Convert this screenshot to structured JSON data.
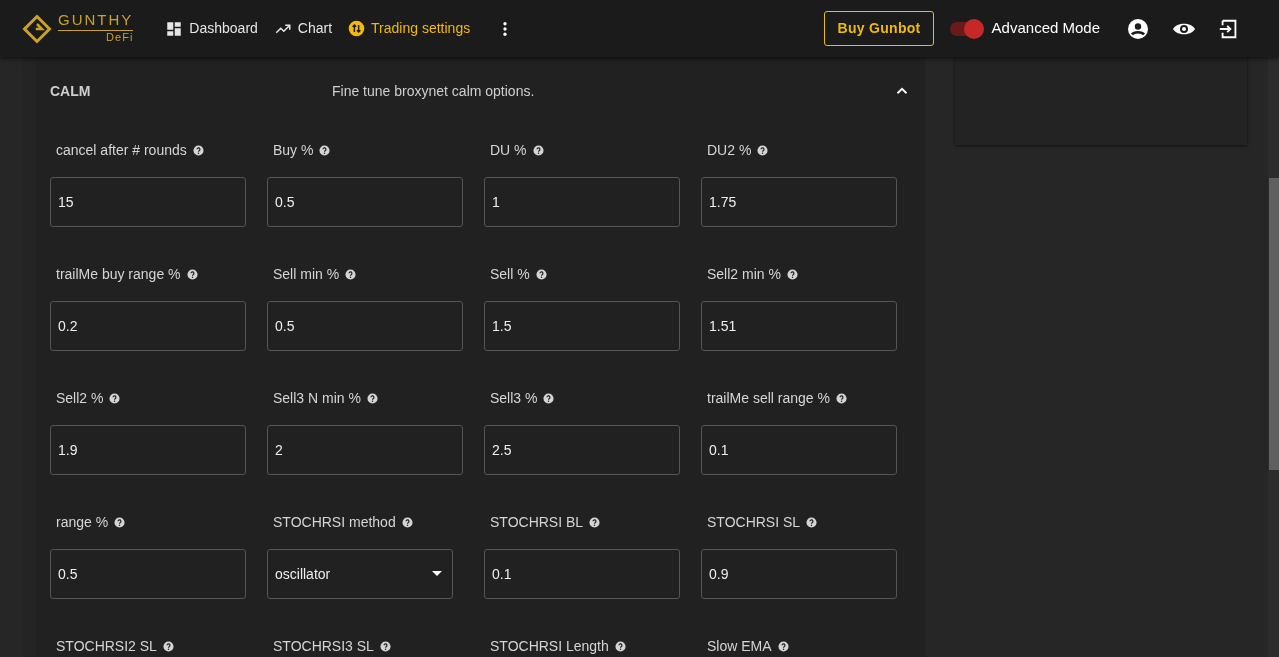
{
  "header": {
    "logo": {
      "name": "GUNTHY",
      "sub": "DeFi"
    },
    "nav": [
      {
        "label": "Dashboard",
        "selected": false
      },
      {
        "label": "Chart",
        "selected": false
      },
      {
        "label": "Trading settings",
        "selected": true
      }
    ],
    "buy_button": "Buy Gunbot",
    "advanced_mode": {
      "label": "Advanced Mode",
      "on": true
    }
  },
  "section": {
    "title": "CALM",
    "description": "Fine tune broxynet calm options.",
    "expanded": true,
    "fields": [
      {
        "label": "cancel after # rounds",
        "kind": "input",
        "value": "15"
      },
      {
        "label": "Buy %",
        "kind": "input",
        "value": "0.5"
      },
      {
        "label": "DU %",
        "kind": "input",
        "value": "1"
      },
      {
        "label": "DU2 %",
        "kind": "input",
        "value": "1.75"
      },
      {
        "label": "trailMe buy range %",
        "kind": "input",
        "value": "0.2"
      },
      {
        "label": "Sell min %",
        "kind": "input",
        "value": "0.5"
      },
      {
        "label": "Sell %",
        "kind": "input",
        "value": "1.5"
      },
      {
        "label": "Sell2 min %",
        "kind": "input",
        "value": "1.51"
      },
      {
        "label": "Sell2 %",
        "kind": "input",
        "value": "1.9"
      },
      {
        "label": "Sell3 N min %",
        "kind": "input",
        "value": "2"
      },
      {
        "label": "Sell3 %",
        "kind": "input",
        "value": "2.5"
      },
      {
        "label": "trailMe sell range %",
        "kind": "input",
        "value": "0.1"
      },
      {
        "label": "range %",
        "kind": "input",
        "value": "0.5"
      },
      {
        "label": "STOCHRSI method",
        "kind": "select",
        "value": "oscillator"
      },
      {
        "label": "STOCHRSI BL",
        "kind": "input",
        "value": "0.1"
      },
      {
        "label": "STOCHRSI SL",
        "kind": "input",
        "value": "0.9"
      },
      {
        "label": "STOCHRSI2 SL"
      },
      {
        "label": "STOCHRSI3 SL"
      },
      {
        "label": "STOCHRSI Length"
      },
      {
        "label": "Slow EMA"
      }
    ]
  }
}
